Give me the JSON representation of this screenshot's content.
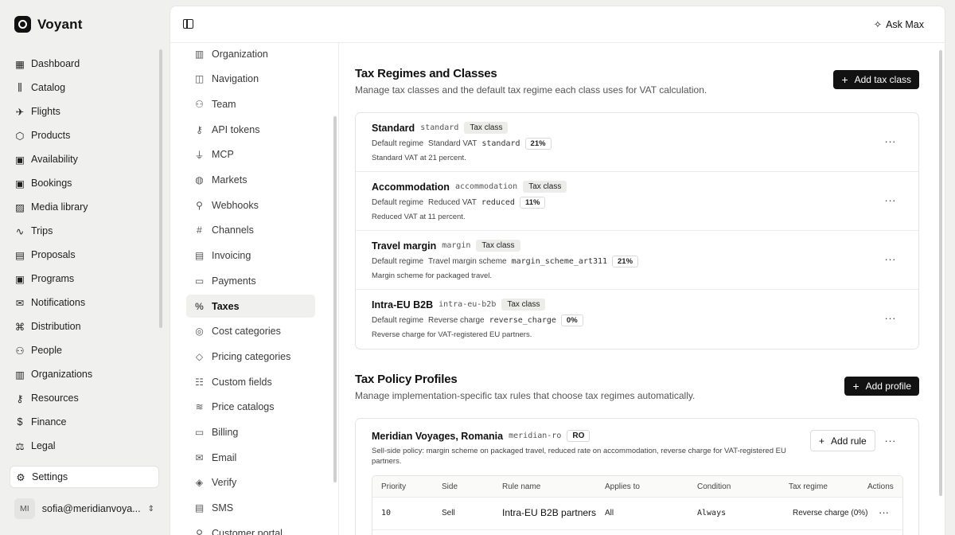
{
  "app": {
    "name": "Voyant"
  },
  "nav": {
    "items": [
      {
        "label": "Dashboard",
        "icon": "grid-icon"
      },
      {
        "label": "Catalog",
        "icon": "library-icon"
      },
      {
        "label": "Flights",
        "icon": "plane-icon"
      },
      {
        "label": "Products",
        "icon": "box-icon"
      },
      {
        "label": "Availability",
        "icon": "calendar-icon"
      },
      {
        "label": "Bookings",
        "icon": "calendar-check-icon"
      },
      {
        "label": "Media library",
        "icon": "image-icon"
      },
      {
        "label": "Trips",
        "icon": "route-icon"
      },
      {
        "label": "Proposals",
        "icon": "file-icon"
      },
      {
        "label": "Programs",
        "icon": "calendar-icon"
      },
      {
        "label": "Notifications",
        "icon": "mail-icon"
      },
      {
        "label": "Distribution",
        "icon": "network-icon"
      },
      {
        "label": "People",
        "icon": "users-icon"
      },
      {
        "label": "Organizations",
        "icon": "building-icon"
      },
      {
        "label": "Resources",
        "icon": "key-icon"
      },
      {
        "label": "Finance",
        "icon": "dollar-icon"
      },
      {
        "label": "Legal",
        "icon": "scale-icon"
      }
    ],
    "settings_label": "Settings",
    "user": {
      "initials": "MI",
      "email": "sofia@meridianvoya..."
    }
  },
  "topbar": {
    "ask_label": "Ask Max"
  },
  "subnav": {
    "items": [
      {
        "label": "Organization",
        "icon": "building-icon"
      },
      {
        "label": "Navigation",
        "icon": "sidebar-icon"
      },
      {
        "label": "Team",
        "icon": "users-icon"
      },
      {
        "label": "API tokens",
        "icon": "key-icon"
      },
      {
        "label": "MCP",
        "icon": "plug-icon"
      },
      {
        "label": "Markets",
        "icon": "globe-icon"
      },
      {
        "label": "Webhooks",
        "icon": "webhook-icon"
      },
      {
        "label": "Channels",
        "icon": "hash-icon"
      },
      {
        "label": "Invoicing",
        "icon": "file-icon"
      },
      {
        "label": "Payments",
        "icon": "card-icon"
      },
      {
        "label": "Taxes",
        "icon": "percent-icon",
        "active": true
      },
      {
        "label": "Cost categories",
        "icon": "coins-icon"
      },
      {
        "label": "Pricing categories",
        "icon": "tag-icon"
      },
      {
        "label": "Custom fields",
        "icon": "sliders-icon"
      },
      {
        "label": "Price catalogs",
        "icon": "layers-icon"
      },
      {
        "label": "Billing",
        "icon": "card-icon"
      },
      {
        "label": "Email",
        "icon": "mail-icon"
      },
      {
        "label": "Verify",
        "icon": "shield-icon"
      },
      {
        "label": "SMS",
        "icon": "message-icon"
      },
      {
        "label": "Customer portal",
        "icon": "user-icon"
      }
    ]
  },
  "tax_regimes": {
    "title": "Tax Regimes and Classes",
    "description": "Manage tax classes and the default tax regime each class uses for VAT calculation.",
    "add_button": "Add tax class",
    "rows": [
      {
        "name": "Standard",
        "code": "standard",
        "badge": "Tax class",
        "default_label": "Default regime",
        "regime": "Standard VAT",
        "regime_code": "standard",
        "rate": "21%",
        "note": "Standard VAT at 21 percent."
      },
      {
        "name": "Accommodation",
        "code": "accommodation",
        "badge": "Tax class",
        "default_label": "Default regime",
        "regime": "Reduced VAT",
        "regime_code": "reduced",
        "rate": "11%",
        "note": "Reduced VAT at 11 percent."
      },
      {
        "name": "Travel margin",
        "code": "margin",
        "badge": "Tax class",
        "default_label": "Default regime",
        "regime": "Travel margin scheme",
        "regime_code": "margin_scheme_art311",
        "rate": "21%",
        "note": "Margin scheme for packaged travel."
      },
      {
        "name": "Intra-EU B2B",
        "code": "intra-eu-b2b",
        "badge": "Tax class",
        "default_label": "Default regime",
        "regime": "Reverse charge",
        "regime_code": "reverse_charge",
        "rate": "0%",
        "note": "Reverse charge for VAT-registered EU partners."
      }
    ]
  },
  "tax_profiles": {
    "title": "Tax Policy Profiles",
    "description": "Manage implementation-specific tax rules that choose tax regimes automatically.",
    "add_button": "Add profile",
    "profile": {
      "name": "Meridian Voyages, Romania",
      "code": "meridian-ro",
      "country": "RO",
      "description": "Sell-side policy: margin scheme on packaged travel, reduced rate on accommodation, reverse charge for VAT-registered EU partners.",
      "add_rule": "Add rule",
      "columns": [
        "Priority",
        "Side",
        "Rule name",
        "Applies to",
        "Condition",
        "Tax regime",
        "Actions"
      ],
      "rows": [
        {
          "priority": "10",
          "side": "Sell",
          "rule_name": "Intra-EU B2B partners",
          "applies_to": "All",
          "condition": "Always",
          "regime": "Reverse charge (0%)"
        }
      ]
    }
  }
}
